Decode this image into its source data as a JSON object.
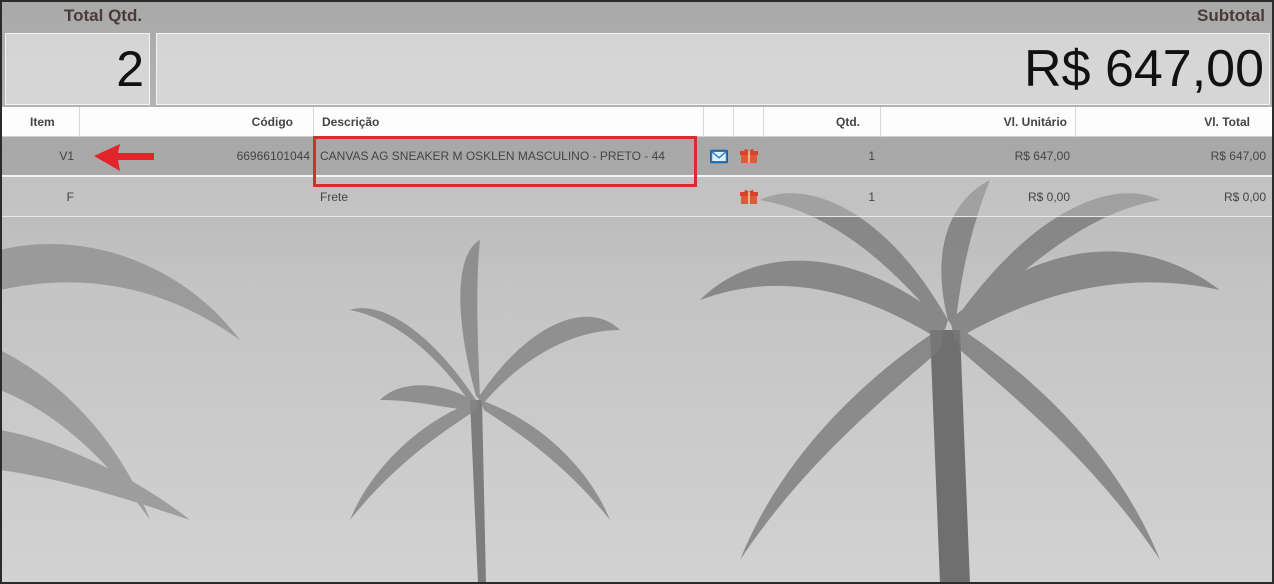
{
  "summary": {
    "total_qty_label": "Total Qtd.",
    "total_qty_value": "2",
    "subtotal_label": "Subtotal",
    "subtotal_value": "R$ 647,00"
  },
  "table": {
    "headers": {
      "item": "Item",
      "codigo": "Código",
      "descricao": "Descrição",
      "qtd": "Qtd.",
      "vl_unitario": "Vl. Unitário",
      "vl_total": "Vl. Total"
    },
    "rows": [
      {
        "item": "V1",
        "codigo": "66966101044",
        "descricao": "CANVAS AG SNEAKER M OSKLEN MASCULINO - PRETO - 44",
        "qtd": "1",
        "vl_unitario": "R$ 647,00",
        "vl_total": "R$ 647,00",
        "icons": [
          "mail-icon",
          "gift-icon"
        ]
      },
      {
        "item": "F",
        "codigo": "",
        "descricao": "Frete",
        "qtd": "1",
        "vl_unitario": "R$ 0,00",
        "vl_total": "R$ 0,00",
        "icons": [
          "gift-icon"
        ]
      }
    ]
  },
  "colors": {
    "highlight_border": "#d32f2f",
    "arrow": "#e0262b",
    "label_text": "#4a3a3a",
    "gift_icon": "#e05a3a",
    "mail_icon": "#2b7bbf"
  }
}
